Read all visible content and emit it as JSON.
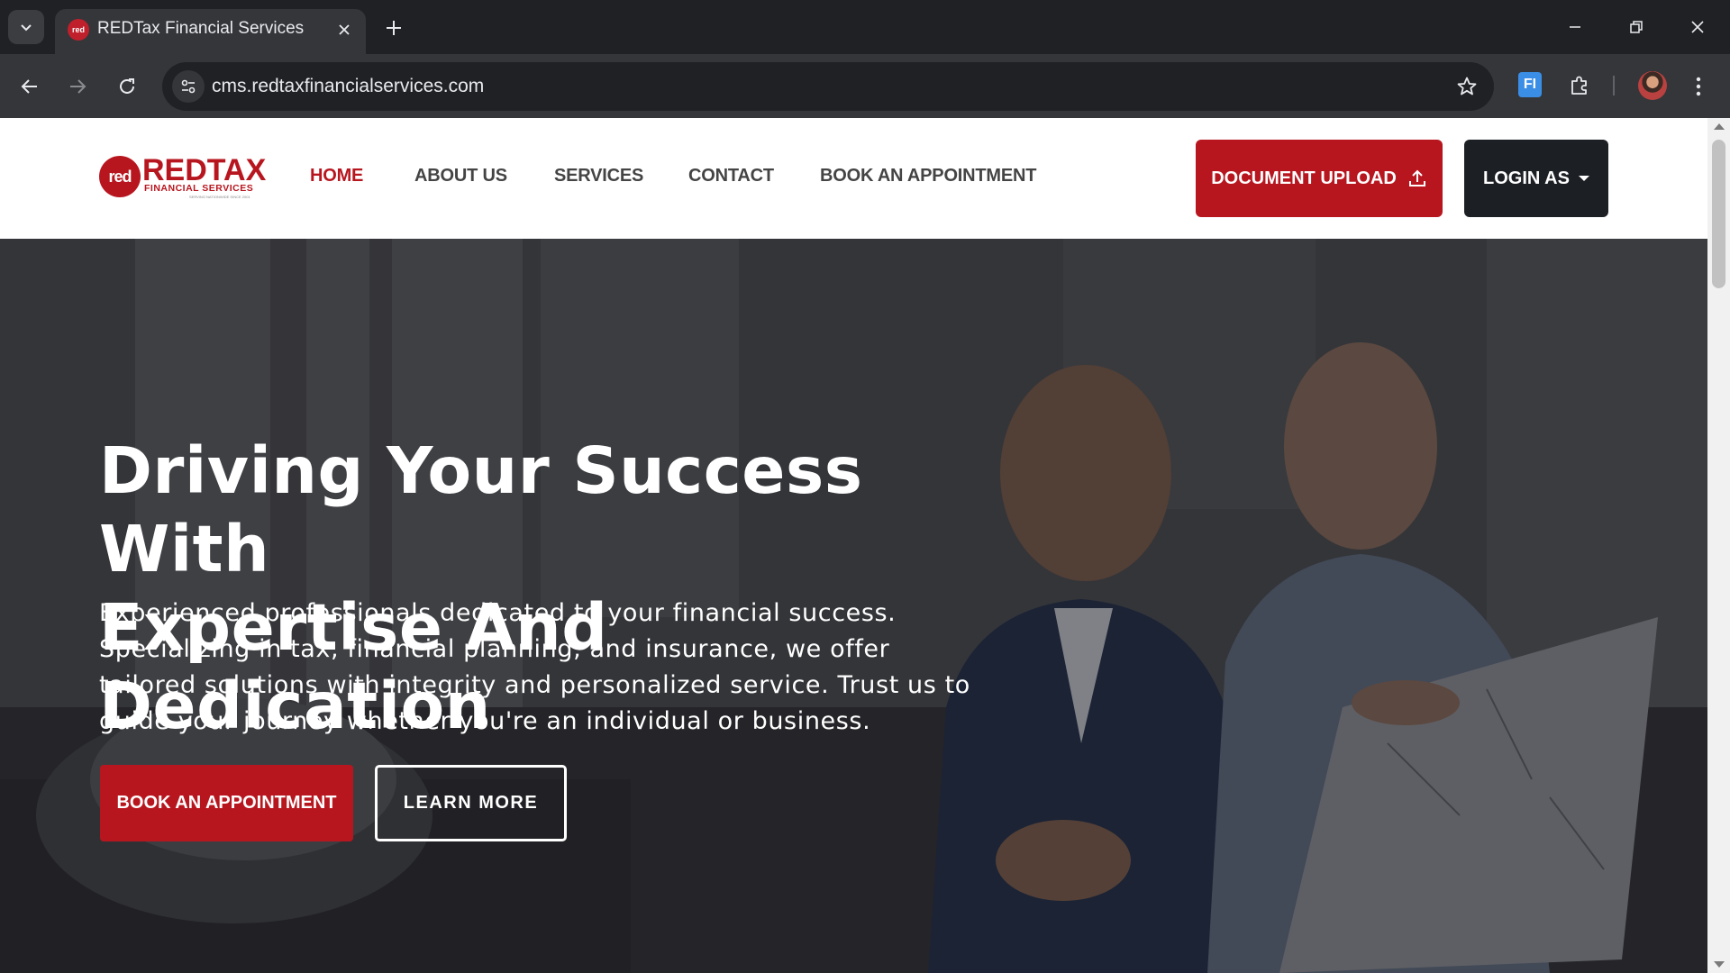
{
  "browser": {
    "tab_title": "REDTax Financial Services",
    "favicon_text": "red",
    "url": "cms.redtaxfinancialservices.com",
    "extension_label": "FI"
  },
  "site": {
    "logo": {
      "badge": "red",
      "main": "REDTAX",
      "sub": "FINANCIAL SERVICES",
      "tagline": "SERVING NATIONWIDE SINCE 2001"
    },
    "nav": {
      "home": "HOME",
      "about": "ABOUT US",
      "services": "SERVICES",
      "contact": "CONTACT",
      "book": "BOOK AN APPOINTMENT"
    },
    "actions": {
      "upload": "DOCUMENT UPLOAD",
      "login": "LOGIN AS"
    },
    "colors": {
      "brand_red": "#b8161f",
      "dark": "#1c1f24"
    }
  },
  "hero": {
    "title_line1": "Driving Your Success With",
    "title_line2": "Expertise And Dedication",
    "text_line1": "Experienced professionals dedicated to your financial success.",
    "text_line2": "Specializing in tax, financial planning, and insurance, we offer",
    "text_line3": "tailored solutions with integrity and personalized service. Trust us to",
    "text_line4": "guide your journey whether you're an individual or business.",
    "cta_primary": "BOOK AN APPOINTMENT",
    "cta_secondary": "LEARN MORE"
  }
}
